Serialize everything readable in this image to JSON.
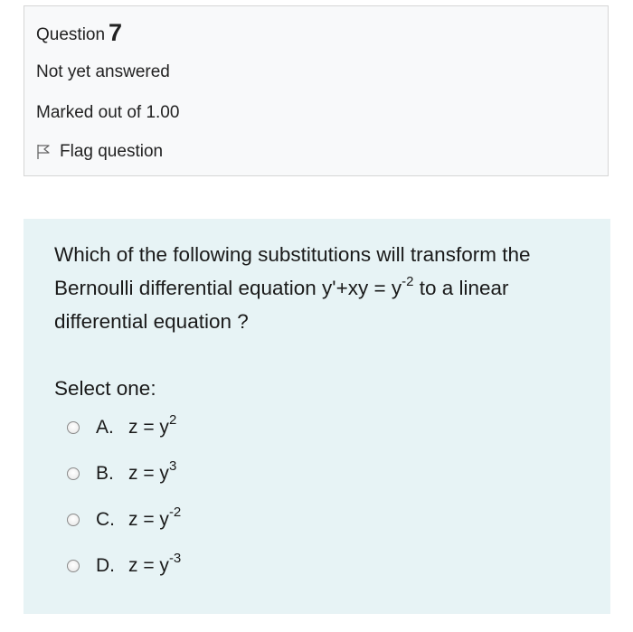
{
  "info": {
    "question_label": "Question",
    "question_number": "7",
    "state": "Not yet answered",
    "grade": "Marked out of 1.00",
    "flag_label": "Flag question"
  },
  "question": {
    "text_before": "Which of the following substitutions will transform the Bernoulli differential equation y'+xy = y",
    "exponent": "-2",
    "text_after": " to a linear differential equation ?"
  },
  "select_label": "Select one:",
  "options": [
    {
      "letter": "A.",
      "base": "z = y",
      "exponent": "2"
    },
    {
      "letter": "B.",
      "base": "z = y",
      "exponent": "3"
    },
    {
      "letter": "C.",
      "base": "z = y",
      "exponent": "-2"
    },
    {
      "letter": "D.",
      "base": "z = y",
      "exponent": "-3"
    }
  ],
  "colors": {
    "info_background": "#f8f9fa",
    "info_border": "#d6d6d6",
    "content_background": "#e7f3f5"
  },
  "icons": {
    "flag": "flag-outline-icon",
    "radio": "radio-unchecked"
  }
}
